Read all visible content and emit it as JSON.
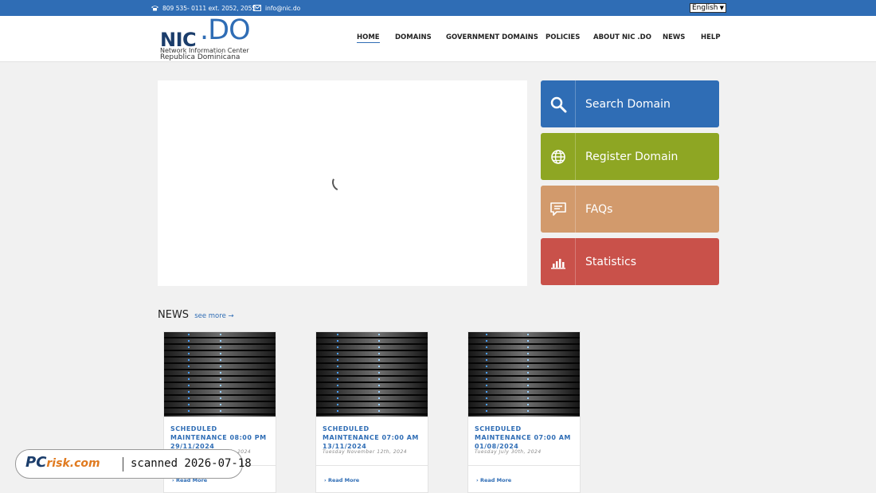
{
  "topbar": {
    "phone": "809 535- 0111 ext. 2052, 2055",
    "email": "info@nic.do",
    "language": "English"
  },
  "header": {
    "logo": {
      "nic": "NIC",
      "do": ".DO",
      "sub1": "Network Information Center",
      "sub2": "Republica Dominicana"
    },
    "nav": [
      "HOME",
      "DOMAINS",
      "GOVERNMENT DOMAINS",
      "POLICIES",
      "ABOUT NIC .DO",
      "NEWS",
      "HELP"
    ],
    "active_nav": "HOME"
  },
  "quick_links": [
    {
      "label": "Search Domain",
      "icon": "search-icon",
      "color": "#2f6db5"
    },
    {
      "label": "Register Domain",
      "icon": "globe-icon",
      "color": "#8ea623"
    },
    {
      "label": "FAQs",
      "icon": "chat-icon",
      "color": "#d29a6c"
    },
    {
      "label": "Statistics",
      "icon": "bar-chart-icon",
      "color": "#c9514a"
    }
  ],
  "news": {
    "heading": "NEWS",
    "see_more": "see more →",
    "items": [
      {
        "title": "SCHEDULED MAINTENANCE 08:00 PM 29/11/2024",
        "date": "th, 2024",
        "read_more": "Read More"
      },
      {
        "title": "SCHEDULED MAINTENANCE 07:00 AM 13/11/2024",
        "date": "Tuesday November 12th, 2024",
        "read_more": "Read More"
      },
      {
        "title": "SCHEDULED MAINTENANCE 07:00 AM 01/08/2024",
        "date": "Tuesday July 30th, 2024",
        "read_more": "Read More"
      }
    ]
  },
  "watermark": {
    "brand": "PC",
    "brand_suffix": "risk.com",
    "scan_text": "scanned 2026-07-18"
  }
}
